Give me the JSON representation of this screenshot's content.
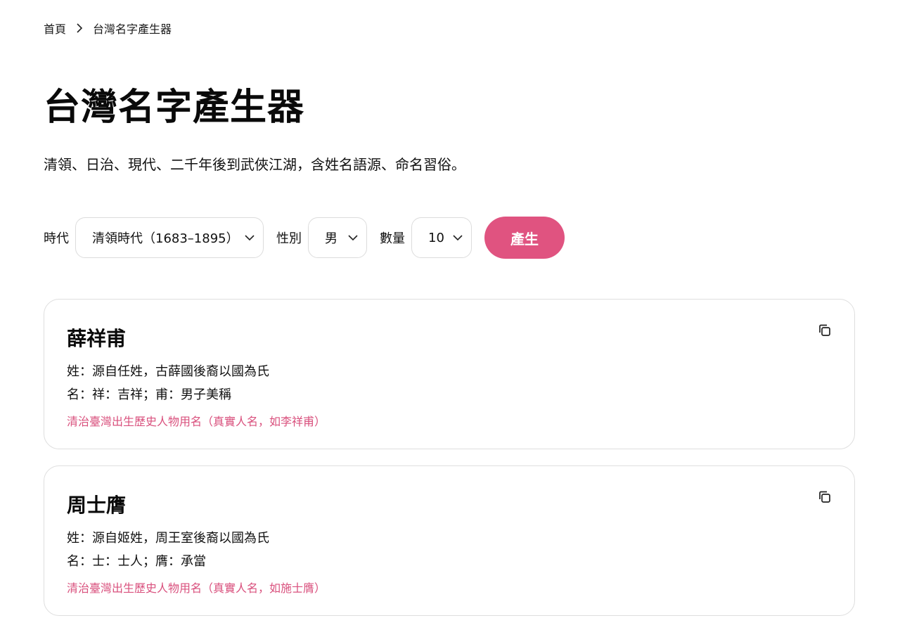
{
  "breadcrumb": {
    "home": "首頁",
    "current": "台灣名字產生器"
  },
  "page": {
    "title": "台灣名字產生器",
    "subtitle": "清領、日治、現代、二千年後到武俠江湖，含姓名語源、命名習俗。"
  },
  "controls": {
    "era_label": "時代",
    "era_value": "清領時代（1683–1895）",
    "gender_label": "性別",
    "gender_value": "男",
    "count_label": "數量",
    "count_value": "10",
    "generate_label": "產生"
  },
  "results": [
    {
      "name": "薛祥甫",
      "surname_origin": "姓：源自任姓，古薛國後裔以國為氏",
      "given_meaning": "名：祥：吉祥；甫：男子美稱",
      "note": "清治臺灣出生歷史人物用名（真實人名，如李祥甫）"
    },
    {
      "name": "周士膺",
      "surname_origin": "姓：源自姬姓，周王室後裔以國為氏",
      "given_meaning": "名：士：士人；膺：承當",
      "note": "清治臺灣出生歷史人物用名（真實人名，如施士膺）"
    }
  ],
  "icons": {
    "breadcrumb_separator": "chevron-right-icon",
    "dropdown": "chevron-down-icon",
    "copy": "copy-icon"
  },
  "colors": {
    "accent": "#e05380",
    "note_text": "#d9507d",
    "card_border": "#dedede"
  }
}
